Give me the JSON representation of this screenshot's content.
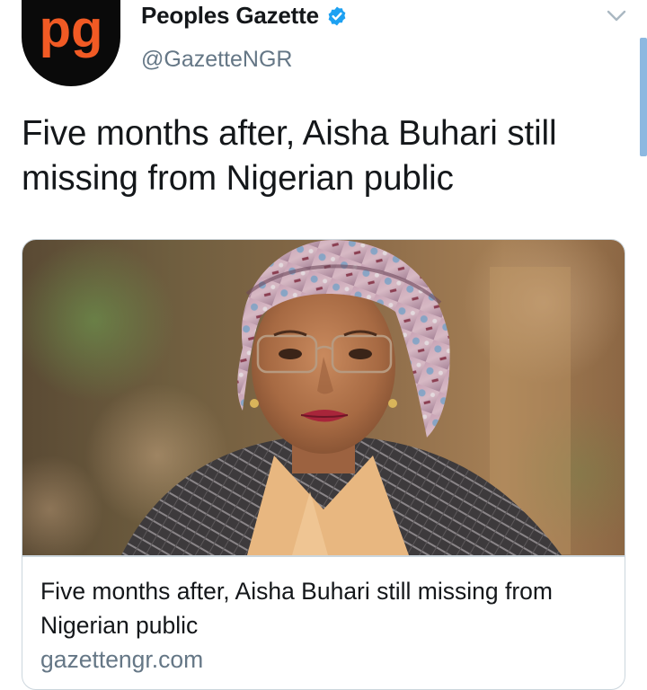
{
  "account": {
    "display_name": "Peoples Gazette",
    "handle": "@GazetteNGR",
    "avatar_text": "pg",
    "verified": true
  },
  "tweet": {
    "text": "Five months after, Aisha Buhari still missing from Nigerian public"
  },
  "card": {
    "title": "Five months after, Aisha Buhari still missing from Nigerian public",
    "domain": "gazettengr.com"
  },
  "icons": {
    "verified": "verified-badge-icon",
    "menu": "chevron-down-icon"
  },
  "colors": {
    "verified": "#1da1f2",
    "avatar_bg": "#0a0a0a",
    "avatar_logo": "#f15a24",
    "secondary_text": "#657786",
    "scroll_indicator": "#8db8e0"
  }
}
